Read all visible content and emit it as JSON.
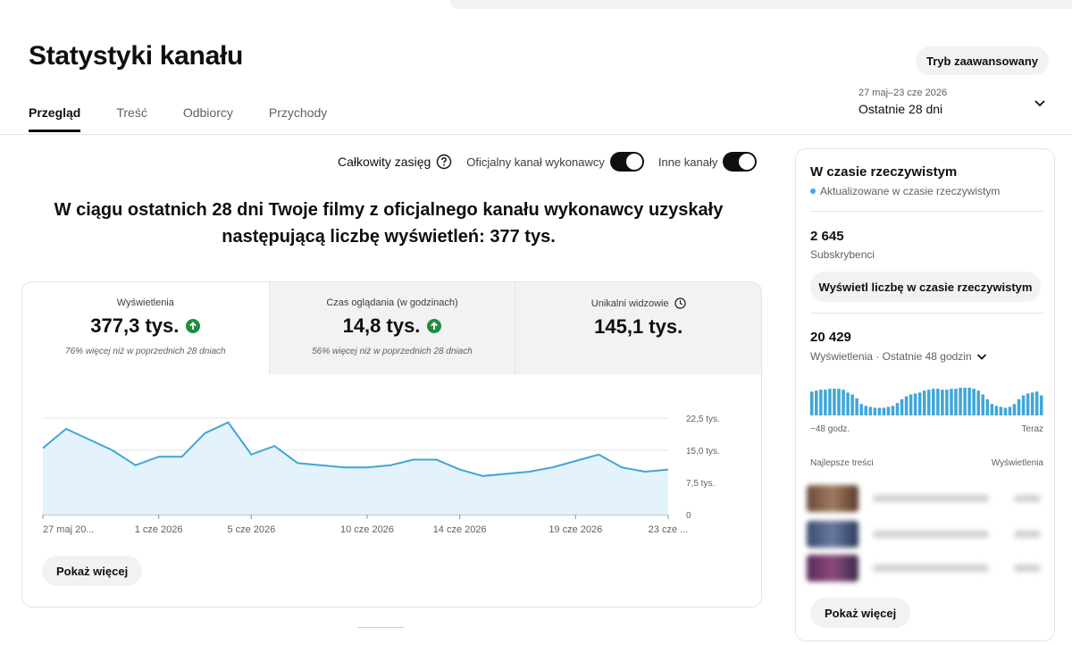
{
  "page": {
    "title": "Statystyki kanału",
    "advanced_button": "Tryb zaawansowany"
  },
  "tabs": [
    {
      "label": "Przegląd",
      "active": true
    },
    {
      "label": "Treść",
      "active": false
    },
    {
      "label": "Odbiorcy",
      "active": false
    },
    {
      "label": "Przychody",
      "active": false
    }
  ],
  "date_picker": {
    "range": "27 maj–23 cze 2026",
    "label": "Ostatnie 28 dni"
  },
  "toggles": {
    "reach_label": "Całkowity zasięg",
    "official_label": "Oficjalny kanał wykonawcy",
    "official_on": true,
    "other_label": "Inne kanały",
    "other_on": true
  },
  "headline": "W ciągu ostatnich 28 dni Twoje filmy z oficjalnego kanału wykonawcy uzyskały następującą liczbę wyświetleń: 377 tys.",
  "metrics": [
    {
      "title": "Wyświetlenia",
      "value": "377,3 tys.",
      "trend": "up",
      "note": "76% więcej niż w poprzednich 28 dniach",
      "selected": true
    },
    {
      "title": "Czas oglądania (w godzinach)",
      "value": "14,8 tys.",
      "trend": "up",
      "note": "56% więcej niż w poprzednich 28 dniach",
      "selected": false
    },
    {
      "title": "Unikalni widzowie",
      "value": "145,1 tys.",
      "trend": "",
      "note": "",
      "selected": false
    }
  ],
  "colors": {
    "line": "#3ea6d6",
    "area": "#e3f2fb",
    "up": "#1e8e3e",
    "accent": "#065fd4"
  },
  "chart_data": {
    "type": "area",
    "x": [
      "27 maj",
      "28 maj",
      "29 maj",
      "30 maj",
      "31 maj",
      "1 cze",
      "2 cze",
      "3 cze",
      "4 cze",
      "5 cze",
      "6 cze",
      "7 cze",
      "8 cze",
      "9 cze",
      "10 cze",
      "11 cze",
      "12 cze",
      "13 cze",
      "14 cze",
      "15 cze",
      "16 cze",
      "17 cze",
      "18 cze",
      "19 cze",
      "20 cze",
      "21 cze",
      "22 cze",
      "23 cze"
    ],
    "values": [
      15500,
      20000,
      17500,
      15000,
      11500,
      13500,
      13500,
      19000,
      21500,
      14000,
      16000,
      12000,
      11500,
      11000,
      11000,
      11500,
      12800,
      12800,
      10500,
      9000,
      9500,
      10000,
      11000,
      12500,
      14000,
      11000,
      10000,
      10500
    ],
    "tick_labels": [
      "27 maj 20...",
      "1 cze 2026",
      "5 cze 2026",
      "10 cze 2026",
      "14 cze 2026",
      "19 cze 2026",
      "23 cze ..."
    ],
    "tick_index": [
      0,
      5,
      9,
      14,
      18,
      23,
      27
    ],
    "y_ticks": [
      0,
      7500,
      15000,
      22500
    ],
    "y_tick_labels": [
      "0",
      "7,5 tys.",
      "15,0 tys.",
      "22,5 tys."
    ],
    "ylim": [
      0,
      22500
    ],
    "title": "",
    "xlabel": "",
    "ylabel": ""
  },
  "show_more": "Pokaż więcej",
  "realtime": {
    "title": "W czasie rzeczywistym",
    "subtitle": "Aktualizowane w czasie rzeczywistym",
    "subscribers_value": "2 645",
    "subscribers_label": "Subskrybenci",
    "live_button": "Wyświetl liczbę w czasie rzeczywistym",
    "views_value": "20 429",
    "views_label": "Wyświetlenia · Ostatnie 48 godzin",
    "axis_start": "−48 godz.",
    "axis_end": "Teraz",
    "top_content_label": "Najlepsze treści",
    "top_views_label": "Wyświetlenia",
    "show_more": "Pokaż więcej",
    "bars": [
      25,
      26,
      27,
      27,
      28,
      28,
      28,
      27,
      24,
      22,
      18,
      12,
      10,
      9,
      8,
      8,
      8,
      9,
      10,
      13,
      17,
      20,
      22,
      23,
      24,
      26,
      27,
      28,
      28,
      27,
      27,
      28,
      28,
      29,
      29,
      29,
      28,
      26,
      22,
      17,
      12,
      10,
      9,
      8,
      9,
      12,
      17,
      21,
      23,
      24,
      25,
      21
    ]
  }
}
